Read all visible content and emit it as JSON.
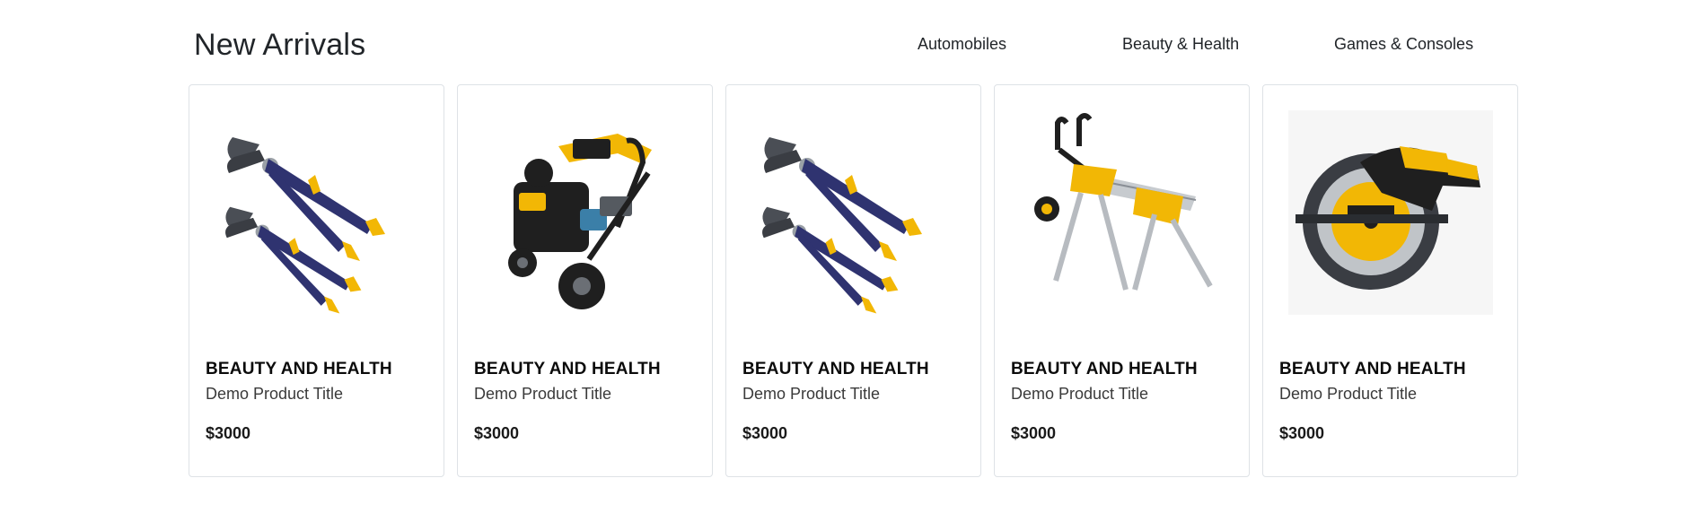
{
  "section": {
    "title": "New Arrivals"
  },
  "tabs": [
    {
      "label": "Automobiles"
    },
    {
      "label": "Beauty & Health"
    },
    {
      "label": "Games & Consoles"
    }
  ],
  "products": [
    {
      "category": "BEAUTY AND HEALTH",
      "title": "Demo Product Title",
      "price": "$3000",
      "image": "pliers-icon"
    },
    {
      "category": "BEAUTY AND HEALTH",
      "title": "Demo Product Title",
      "price": "$3000",
      "image": "pressure-washer-icon"
    },
    {
      "category": "BEAUTY AND HEALTH",
      "title": "Demo Product Title",
      "price": "$3000",
      "image": "pliers-icon"
    },
    {
      "category": "BEAUTY AND HEALTH",
      "title": "Demo Product Title",
      "price": "$3000",
      "image": "saw-stand-icon"
    },
    {
      "category": "BEAUTY AND HEALTH",
      "title": "Demo Product Title",
      "price": "$3000",
      "image": "circular-saw-icon"
    }
  ],
  "colors": {
    "tool_yellow": "#f2b705",
    "handle_navy": "#2f3370",
    "steel_gray": "#8a8f96",
    "dark_body": "#1f1f1f",
    "card_border": "#dee2e6"
  }
}
